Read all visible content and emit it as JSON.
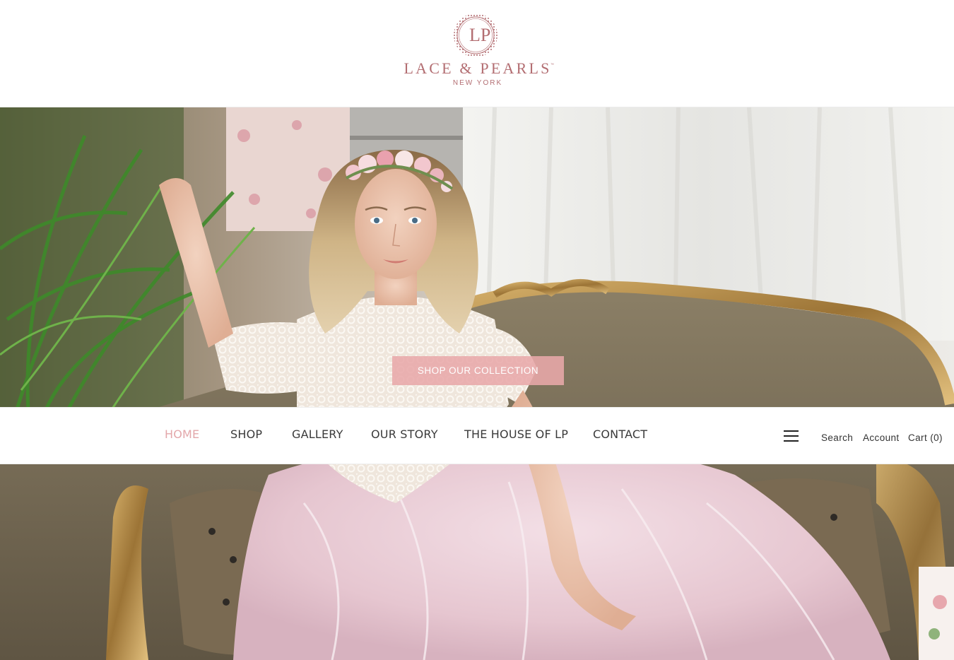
{
  "brand": {
    "monogram": "LP",
    "name": "LACE & PEARLS",
    "trademark": "™",
    "location": "NEW YORK",
    "color": "#b36e72"
  },
  "hero": {
    "cta_label": "SHOP OUR COLLECTION",
    "cta_color": "#e8a8aa"
  },
  "nav": {
    "items": [
      {
        "label": "HOME",
        "active": true
      },
      {
        "label": "SHOP",
        "active": false
      },
      {
        "label": "GALLERY",
        "active": false
      },
      {
        "label": "OUR STORY",
        "active": false
      },
      {
        "label": "THE HOUSE OF LP",
        "active": false
      },
      {
        "label": "CONTACT",
        "active": false
      }
    ],
    "active_color": "#e3a7aa",
    "menu_icon": "hamburger-icon"
  },
  "utility": {
    "search_label": "Search",
    "account_label": "Account",
    "cart_label": "Cart (0)"
  }
}
